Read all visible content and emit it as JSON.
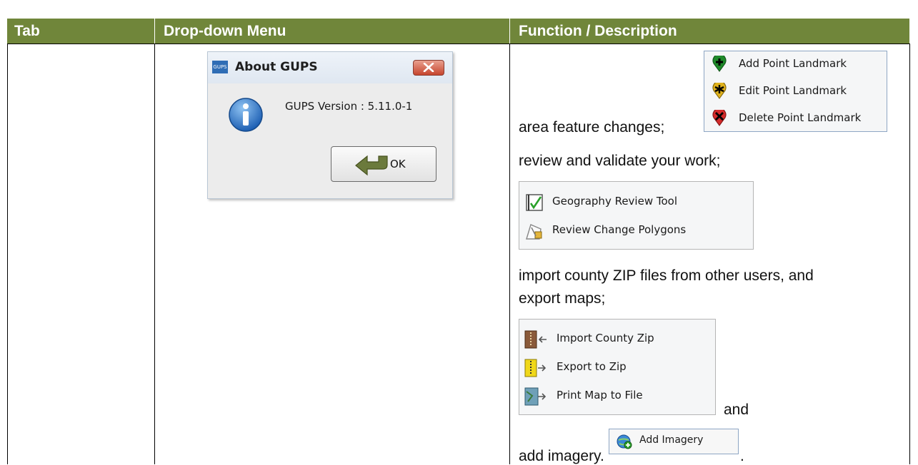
{
  "table": {
    "headers": [
      "Tab",
      "Drop-down Menu",
      "Function / Description"
    ]
  },
  "about_dialog": {
    "app_icon_text": "GUPS",
    "title": "About GUPS",
    "message": "GUPS Version : 5.11.0-1",
    "ok_label": "OK"
  },
  "description": {
    "line1": "area feature changes;",
    "line2": "review and validate your work;",
    "line3a": "import county ZIP files from other users, and",
    "line3b": "export maps;",
    "line4": "and",
    "line5a": "add imagery.",
    "line5b": "."
  },
  "landmark_menu": {
    "items": [
      {
        "label": "Add Point Landmark",
        "icon": "green-plus-pin-icon"
      },
      {
        "label": "Edit Point Landmark",
        "icon": "yellow-star-pin-icon"
      },
      {
        "label": "Delete Point Landmark",
        "icon": "red-x-pin-icon"
      }
    ]
  },
  "review_menu": {
    "items": [
      {
        "label": "Geography Review Tool",
        "icon": "check-review-icon"
      },
      {
        "label": "Review Change Polygons",
        "icon": "polygon-lock-icon"
      }
    ]
  },
  "file_menu": {
    "items": [
      {
        "label": "Import County Zip",
        "icon": "import-zip-icon"
      },
      {
        "label": "Export to Zip",
        "icon": "export-zip-icon"
      },
      {
        "label": "Print Map to File",
        "icon": "print-map-icon"
      }
    ]
  },
  "imagery_button": {
    "label": "Add Imagery",
    "icon": "add-globe-icon"
  }
}
